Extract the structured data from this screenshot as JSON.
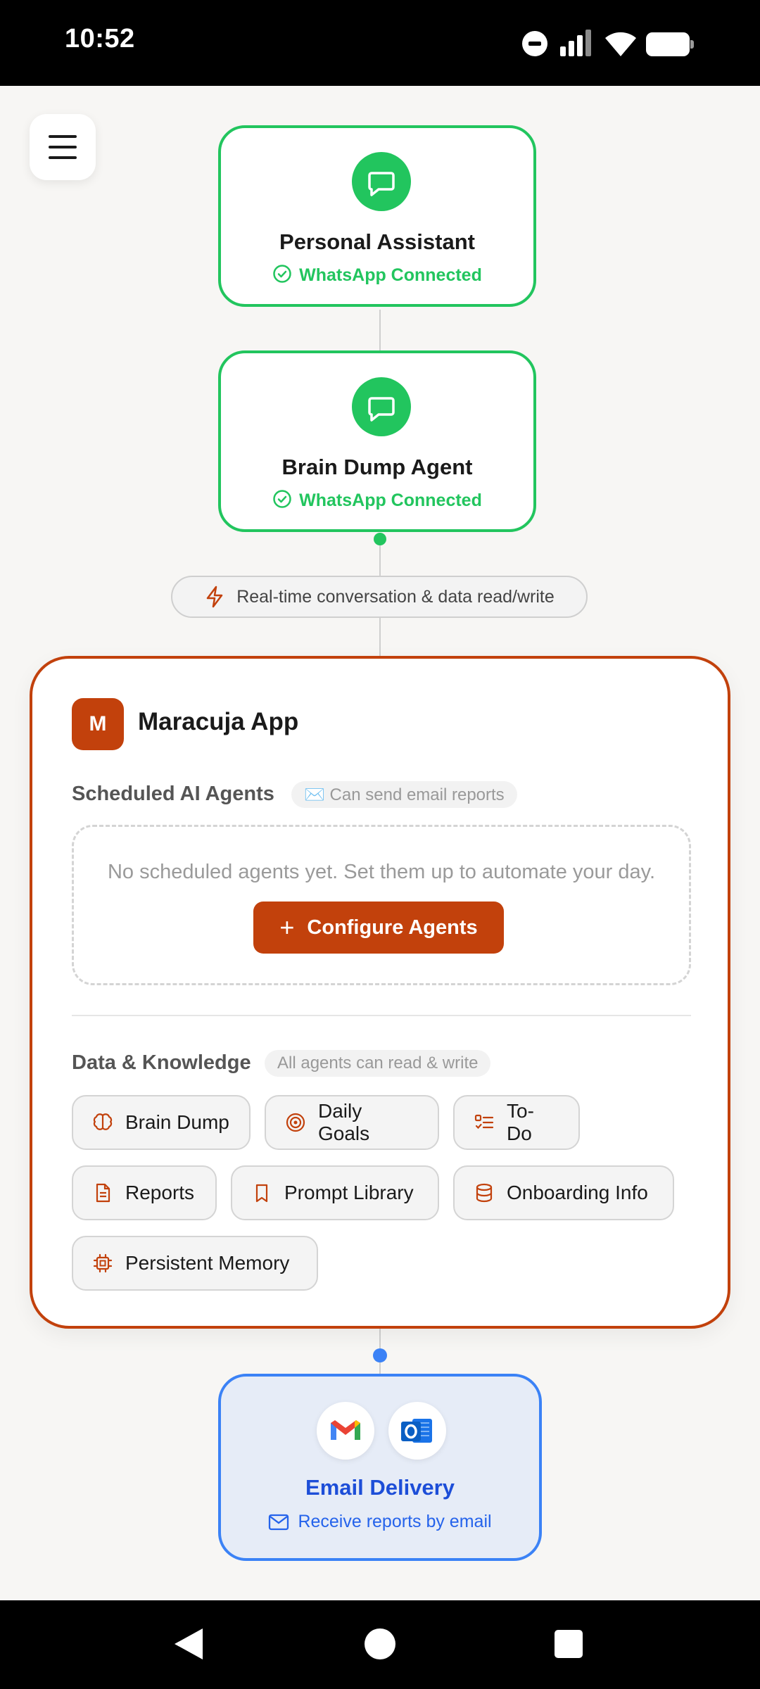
{
  "status_bar": {
    "time": "10:52"
  },
  "agents": [
    {
      "name": "Personal Assistant",
      "status": "WhatsApp Connected"
    },
    {
      "name": "Brain Dump Agent",
      "status": "WhatsApp Connected"
    }
  ],
  "connection": {
    "label": "Real-time conversation & data read/write"
  },
  "app": {
    "logo_letter": "M",
    "name": "Maracuja App",
    "scheduled": {
      "title": "Scheduled AI Agents",
      "badge": "✉️ Can send email reports",
      "empty_text": "No scheduled agents yet. Set them up to automate your day.",
      "configure_label": "Configure Agents"
    },
    "data": {
      "title": "Data & Knowledge",
      "badge": "All agents can read & write",
      "items": [
        "Brain Dump",
        "Daily Goals",
        "To-Do",
        "Reports",
        "Prompt Library",
        "Onboarding Info",
        "Persistent Memory"
      ]
    }
  },
  "email": {
    "title": "Email Delivery",
    "subtitle": "Receive reports by email"
  },
  "colors": {
    "green": "#22c55e",
    "accent": "#c2410c",
    "blue": "#3b82f6"
  }
}
